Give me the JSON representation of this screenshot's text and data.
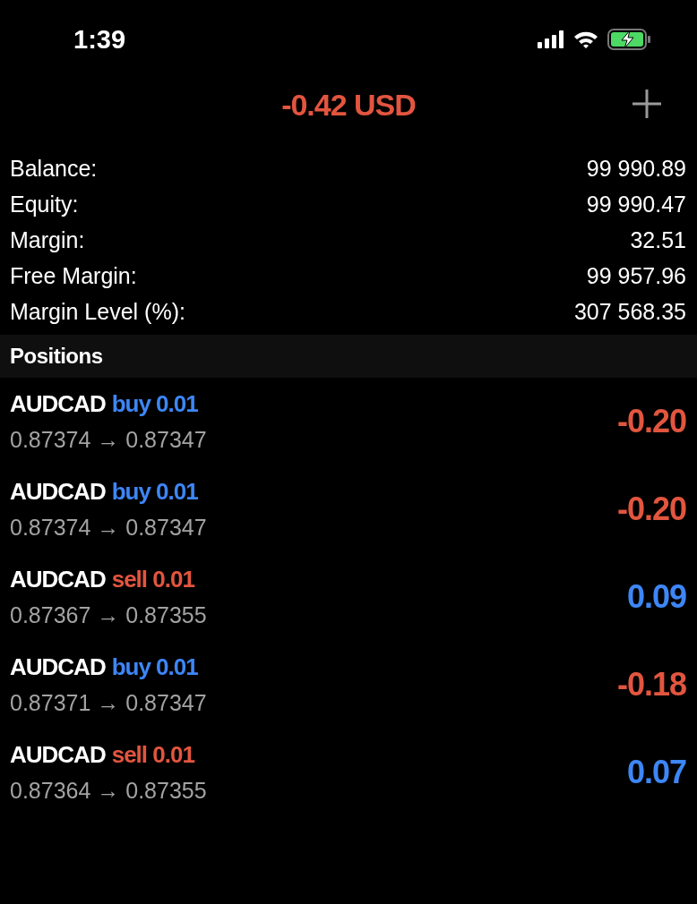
{
  "status_bar": {
    "time": "1:39"
  },
  "header": {
    "total": "-0.42 USD",
    "color": "#e2553f"
  },
  "summary": [
    {
      "label": "Balance:",
      "value": "99 990.89"
    },
    {
      "label": "Equity:",
      "value": "99 990.47"
    },
    {
      "label": "Margin:",
      "value": "32.51"
    },
    {
      "label": "Free Margin:",
      "value": "99 957.96"
    },
    {
      "label": "Margin Level (%):",
      "value": "307 568.35"
    }
  ],
  "positions_header": "Positions",
  "positions": [
    {
      "symbol": "AUDCAD",
      "order": "buy 0.01",
      "kind": "buy",
      "prices": "0.87374 → 0.87347",
      "profit": "-0.20",
      "color": "#e2553f"
    },
    {
      "symbol": "AUDCAD",
      "order": "buy 0.01",
      "kind": "buy",
      "prices": "0.87374 → 0.87347",
      "profit": "-0.20",
      "color": "#e2553f"
    },
    {
      "symbol": "AUDCAD",
      "order": "sell 0.01",
      "kind": "sell",
      "prices": "0.87367 → 0.87355",
      "profit": "0.09",
      "color": "#3d86f6"
    },
    {
      "symbol": "AUDCAD",
      "order": "buy 0.01",
      "kind": "buy",
      "prices": "0.87371 → 0.87347",
      "profit": "-0.18",
      "color": "#e2553f"
    },
    {
      "symbol": "AUDCAD",
      "order": "sell 0.01",
      "kind": "sell",
      "prices": "0.87364 → 0.87355",
      "profit": "0.07",
      "color": "#3d86f6"
    }
  ]
}
